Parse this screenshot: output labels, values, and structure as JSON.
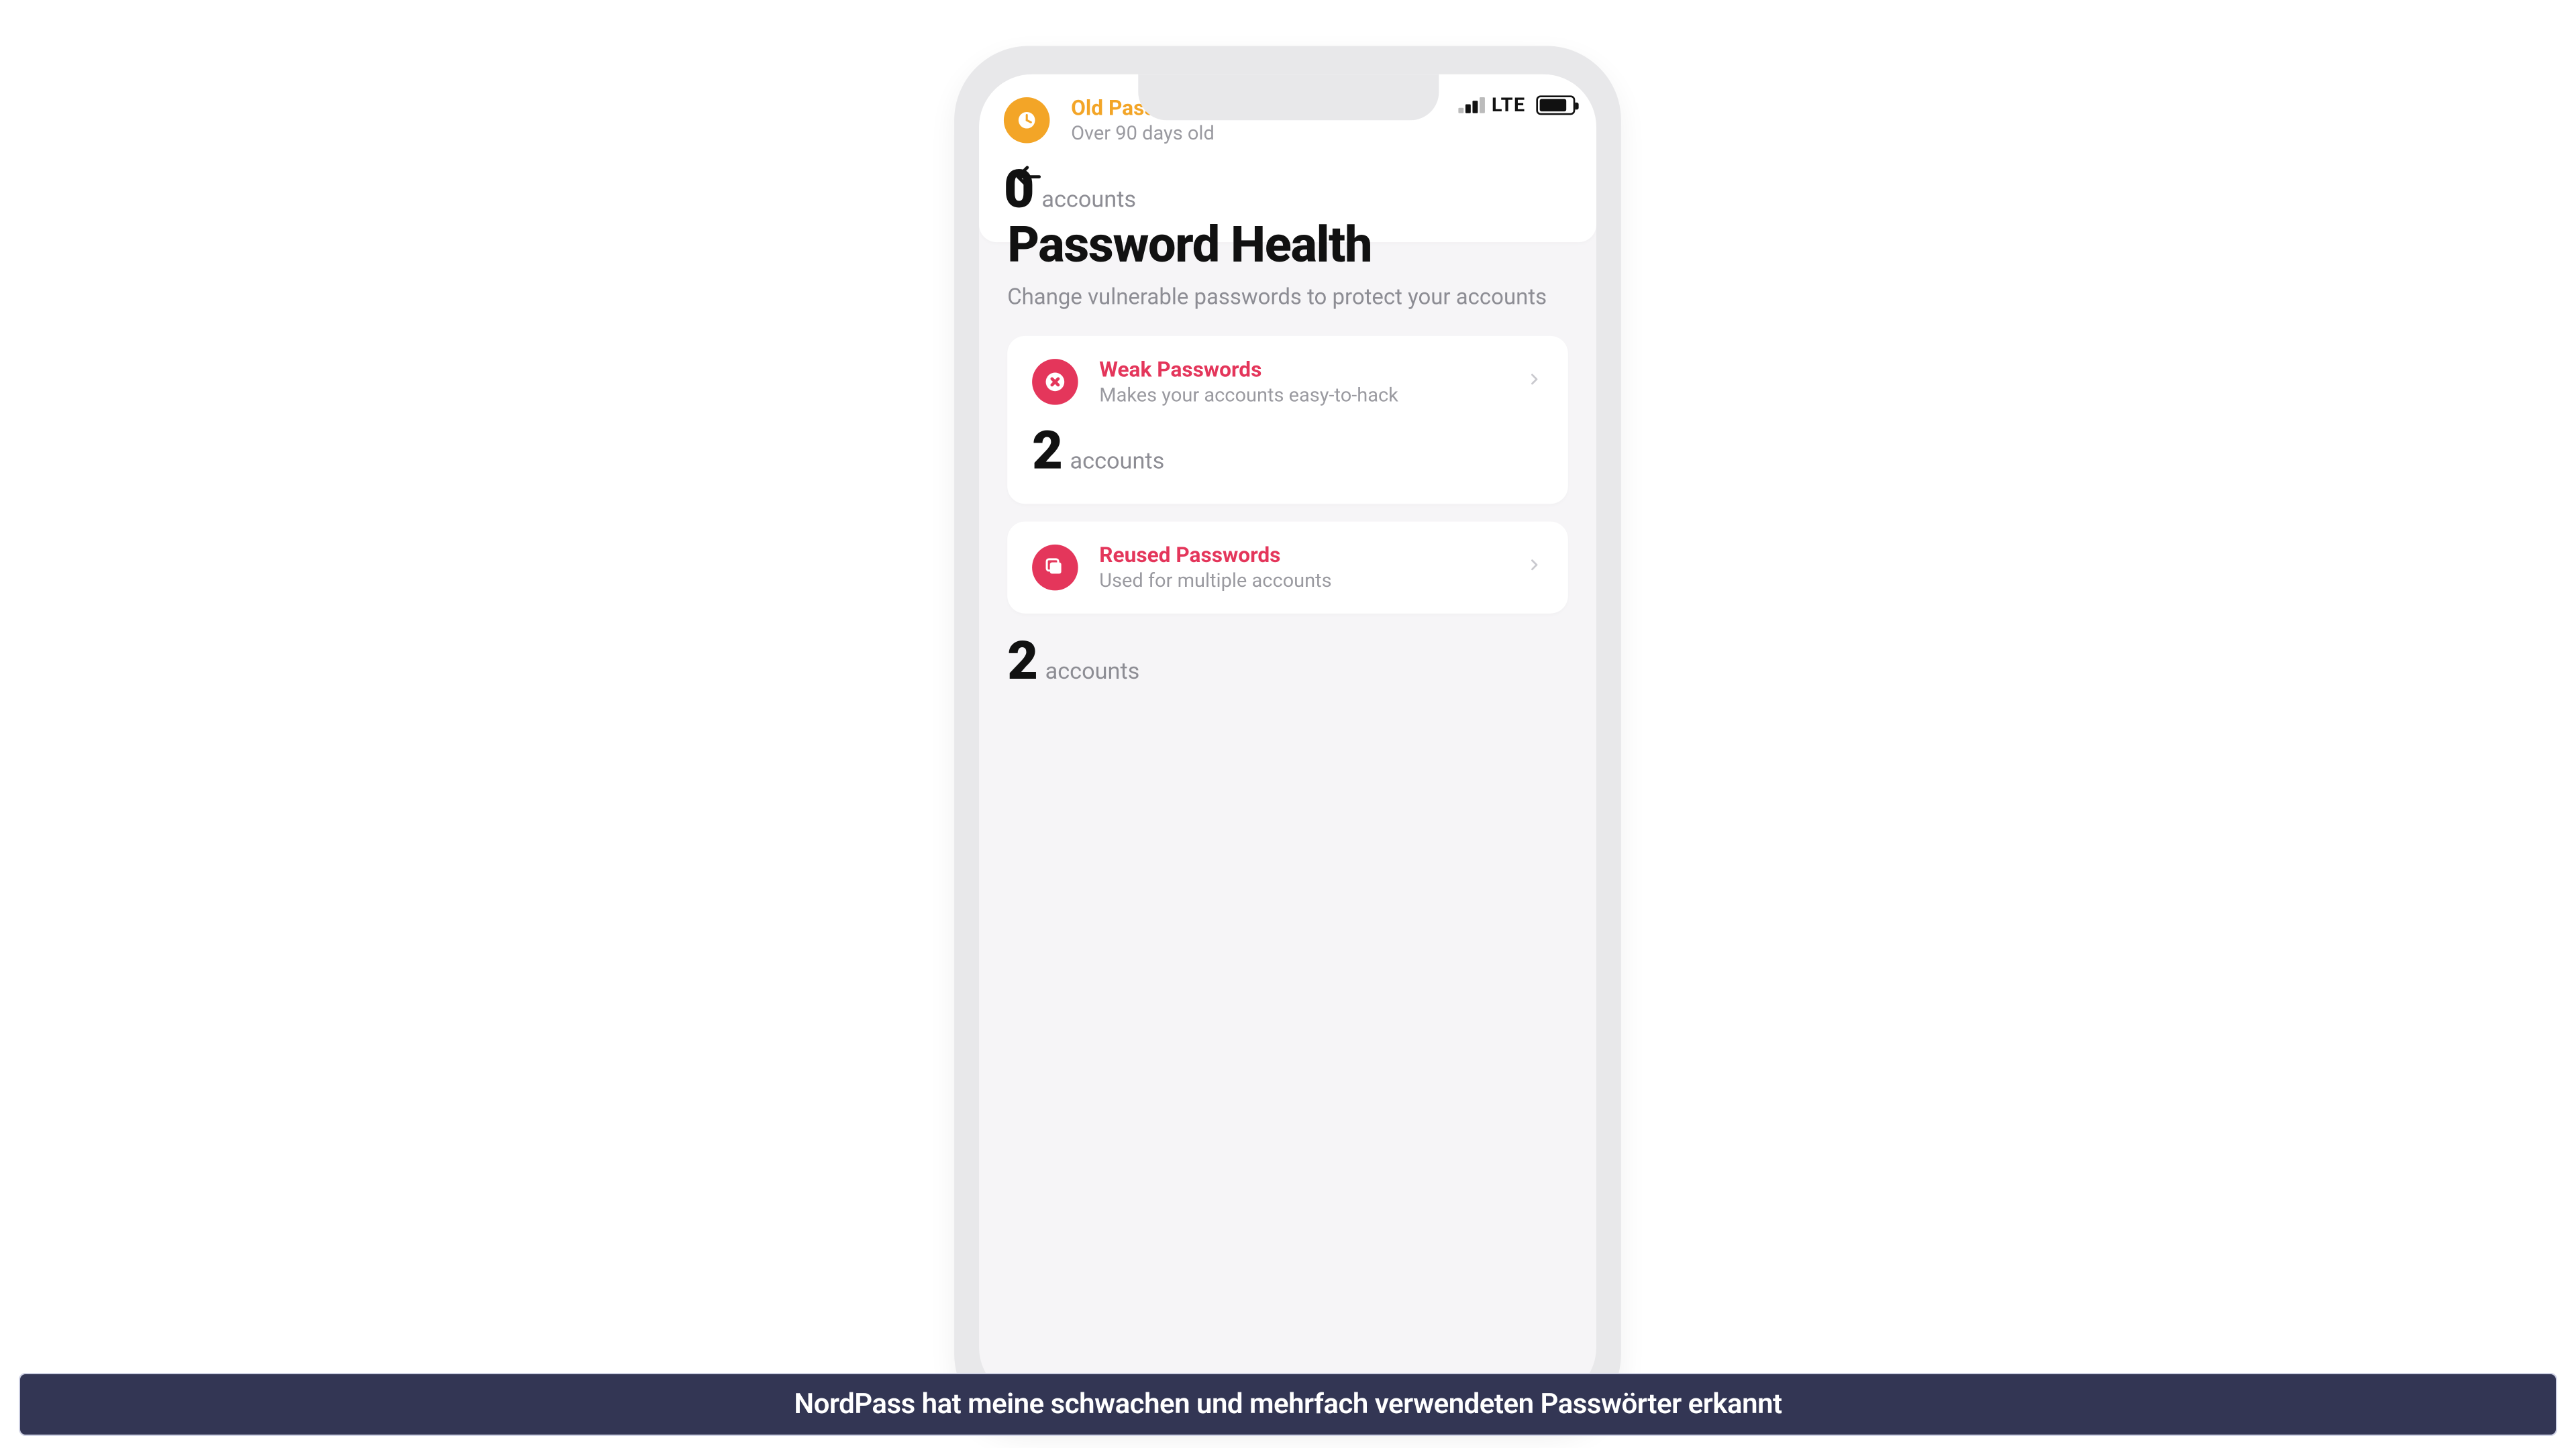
{
  "status_bar": {
    "network_label": "LTE"
  },
  "header": {
    "title": "Password Health",
    "subtitle": "Change vulnerable passwords to protect your accounts"
  },
  "cards": {
    "weak": {
      "title": "Weak Passwords",
      "subtitle": "Makes your accounts easy-to-hack",
      "count": "2",
      "count_label": "accounts",
      "icon": "x-circle-icon",
      "color": "#e4365b"
    },
    "reused": {
      "title": "Reused Passwords",
      "subtitle": "Used for multiple accounts",
      "count": "2",
      "count_label": "accounts",
      "icon": "copy-icon",
      "color": "#e4365b"
    },
    "old": {
      "title": "Old Passwords",
      "subtitle": "Over 90 days old",
      "count": "0",
      "count_label": "accounts",
      "icon": "clock-icon",
      "color": "#f3a527"
    }
  },
  "caption": {
    "text": "NordPass hat meine schwachen und mehrfach verwendeten Passwörter erkannt",
    "bg": "#333654"
  }
}
